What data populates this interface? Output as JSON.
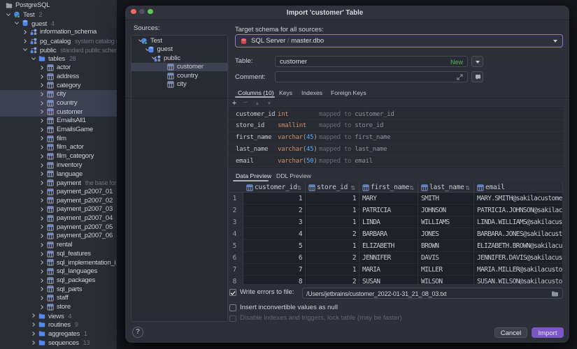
{
  "window": {
    "title": "Import 'customer' Table"
  },
  "sidebar": {
    "items": [
      {
        "label": "PostgreSQL",
        "level": 0,
        "icon": "folder-gray",
        "chevron": "none"
      },
      {
        "label": "Test",
        "level": 1,
        "icon": "postgresql",
        "chevron": "down",
        "badge": "2"
      },
      {
        "label": "guest",
        "level": 2,
        "icon": "database",
        "chevron": "down",
        "badge": "4"
      },
      {
        "label": "information_schema",
        "level": 3,
        "icon": "schema",
        "chevron": "right"
      },
      {
        "label": "pg_catalog",
        "level": 3,
        "icon": "schema",
        "chevron": "right",
        "note": "system catalog s"
      },
      {
        "label": "public",
        "level": 3,
        "icon": "schema",
        "chevron": "down",
        "note": "standard public schema"
      },
      {
        "label": "tables",
        "level": 4,
        "icon": "folder-blue",
        "chevron": "down",
        "badge": "28"
      },
      {
        "label": "actor",
        "level": 5,
        "icon": "table",
        "chevron": "right"
      },
      {
        "label": "address",
        "level": 5,
        "icon": "table",
        "chevron": "right"
      },
      {
        "label": "category",
        "level": 5,
        "icon": "table",
        "chevron": "right"
      },
      {
        "label": "city",
        "level": 5,
        "icon": "table",
        "chevron": "right",
        "selected": true
      },
      {
        "label": "country",
        "level": 5,
        "icon": "table",
        "chevron": "right",
        "selected": true
      },
      {
        "label": "customer",
        "level": 5,
        "icon": "table",
        "chevron": "right",
        "selected": true
      },
      {
        "label": "EmailsAll1",
        "level": 5,
        "icon": "table",
        "chevron": "right"
      },
      {
        "label": "EmailsGame",
        "level": 5,
        "icon": "table",
        "chevron": "right"
      },
      {
        "label": "film",
        "level": 5,
        "icon": "table",
        "chevron": "right"
      },
      {
        "label": "film_actor",
        "level": 5,
        "icon": "table",
        "chevron": "right"
      },
      {
        "label": "film_category",
        "level": 5,
        "icon": "table",
        "chevron": "right"
      },
      {
        "label": "inventory",
        "level": 5,
        "icon": "table",
        "chevron": "right"
      },
      {
        "label": "language",
        "level": 5,
        "icon": "table",
        "chevron": "right"
      },
      {
        "label": "payment",
        "level": 5,
        "icon": "table",
        "chevron": "right",
        "note": "the base for (p"
      },
      {
        "label": "payment_p2007_01",
        "level": 5,
        "icon": "table",
        "chevron": "right"
      },
      {
        "label": "payment_p2007_02",
        "level": 5,
        "icon": "table",
        "chevron": "right"
      },
      {
        "label": "payment_p2007_03",
        "level": 5,
        "icon": "table",
        "chevron": "right"
      },
      {
        "label": "payment_p2007_04",
        "level": 5,
        "icon": "table",
        "chevron": "right"
      },
      {
        "label": "payment_p2007_05",
        "level": 5,
        "icon": "table",
        "chevron": "right"
      },
      {
        "label": "payment_p2007_06",
        "level": 5,
        "icon": "table",
        "chevron": "right"
      },
      {
        "label": "rental",
        "level": 5,
        "icon": "table",
        "chevron": "right"
      },
      {
        "label": "sql_features",
        "level": 5,
        "icon": "table",
        "chevron": "right"
      },
      {
        "label": "sql_implementation_i",
        "level": 5,
        "icon": "table",
        "chevron": "right"
      },
      {
        "label": "sql_languages",
        "level": 5,
        "icon": "table",
        "chevron": "right"
      },
      {
        "label": "sql_packages",
        "level": 5,
        "icon": "table",
        "chevron": "right"
      },
      {
        "label": "sql_parts",
        "level": 5,
        "icon": "table",
        "chevron": "right"
      },
      {
        "label": "staff",
        "level": 5,
        "icon": "table",
        "chevron": "right"
      },
      {
        "label": "store",
        "level": 5,
        "icon": "table",
        "chevron": "right"
      },
      {
        "label": "views",
        "level": 4,
        "icon": "folder-blue",
        "chevron": "right",
        "badge": "4"
      },
      {
        "label": "routines",
        "level": 4,
        "icon": "folder-blue",
        "chevron": "right",
        "badge": "9"
      },
      {
        "label": "aggregates",
        "level": 4,
        "icon": "folder-blue",
        "chevron": "right",
        "badge": "1"
      },
      {
        "label": "sequences",
        "level": 4,
        "icon": "folder-blue",
        "chevron": "right",
        "badge": "13"
      }
    ]
  },
  "dialog": {
    "traffic_lights": {
      "close": "#ec6a5e",
      "minimize": "#50535c",
      "zoom": "#62c554"
    },
    "sources": {
      "label": "Sources:",
      "tree": [
        {
          "label": "Test",
          "level": 0,
          "icon": "postgresql",
          "chevron": "down"
        },
        {
          "label": "guest",
          "level": 1,
          "icon": "database",
          "chevron": "down"
        },
        {
          "label": "public",
          "level": 2,
          "icon": "schema",
          "chevron": "down"
        },
        {
          "label": "customer",
          "level": 3,
          "icon": "table",
          "chevron": "none",
          "selected": true
        },
        {
          "label": "country",
          "level": 3,
          "icon": "table",
          "chevron": "none"
        },
        {
          "label": "city",
          "level": 3,
          "icon": "table",
          "chevron": "none"
        }
      ]
    },
    "target_schema": {
      "label": "Target schema for all sources:",
      "dbms": "SQL Server",
      "separator": "/",
      "schema": "master.dbo"
    },
    "table_row": {
      "label": "Table:",
      "value": "customer",
      "badge": "New"
    },
    "comment_row": {
      "label": "Comment:",
      "value": ""
    },
    "tabs": [
      {
        "label": "Columns (10)",
        "selected": true
      },
      {
        "label": "Keys",
        "selected": false
      },
      {
        "label": "Indexes",
        "selected": false
      },
      {
        "label": "Foreign Keys",
        "selected": false
      }
    ],
    "toolbar": {
      "add": "+",
      "remove": "−",
      "up": "▲",
      "down": "▼"
    },
    "columns": [
      {
        "name": "customer_id",
        "type": "int",
        "size": "",
        "mapped_prefix": "mapped to",
        "mapped": "customer_id"
      },
      {
        "name": "store_id",
        "type": "smallint",
        "size": "",
        "mapped_prefix": "mapped to",
        "mapped": "store_id"
      },
      {
        "name": "first_name",
        "type": "varchar",
        "size": "45",
        "mapped_prefix": "mapped to",
        "mapped": "first_name"
      },
      {
        "name": "last_name",
        "type": "varchar",
        "size": "45",
        "mapped_prefix": "mapped to",
        "mapped": "last_name"
      },
      {
        "name": "email",
        "type": "varchar",
        "size": "50",
        "mapped_prefix": "mapped to",
        "mapped": "email"
      }
    ],
    "preview_tabs": [
      {
        "label": "Data Preview",
        "selected": true
      },
      {
        "label": "DDL Preview",
        "selected": false
      }
    ],
    "grid": {
      "columns": [
        "customer_id",
        "store_id",
        "first_name",
        "last_name",
        "email"
      ],
      "row_numbers": [
        "1",
        "2",
        "3",
        "4",
        "5",
        "6",
        "7",
        "8"
      ],
      "rows": [
        [
          "1",
          "1",
          "MARY",
          "SMITH",
          "MARY.SMITH@sakilacustomer."
        ],
        [
          "2",
          "1",
          "PATRICIA",
          "JOHNSON",
          "PATRICIA.JOHNSON@sakilacus"
        ],
        [
          "3",
          "1",
          "LINDA",
          "WILLIAMS",
          "LINDA.WILLIAMS@sakilacusto"
        ],
        [
          "4",
          "2",
          "BARBARA",
          "JONES",
          "BARBARA.JONES@sakilacustom"
        ],
        [
          "5",
          "1",
          "ELIZABETH",
          "BROWN",
          "ELIZABETH.BROWN@sakilacust"
        ],
        [
          "6",
          "2",
          "JENNIFER",
          "DAVIS",
          "JENNIFER.DAVIS@sakilacusto"
        ],
        [
          "7",
          "1",
          "MARIA",
          "MILLER",
          "MARIA.MILLER@sakilacustome"
        ],
        [
          "8",
          "2",
          "SUSAN",
          "WILSON",
          "SUSAN.WILSON@sakilacustome"
        ]
      ]
    },
    "options": [
      {
        "checked": true,
        "disabled": false,
        "label": "Write errors to file:",
        "value": "/Users/jetbrains/customer_2022-01-31_21_08_03.txt"
      },
      {
        "checked": false,
        "disabled": false,
        "label": "Insert inconvertible values as null"
      },
      {
        "checked": false,
        "disabled": true,
        "label": "Disable indexes and triggers, lock table (may be faster)"
      }
    ],
    "buttons": {
      "cancel": "Cancel",
      "import": "Import"
    },
    "help": "?"
  },
  "colors": {
    "accent_purple": "#7d57c6",
    "combo_focus_border": "#9a72d8",
    "new_badge_green": "#58b45e",
    "type_orange": "#cf8e6d",
    "number_blue": "#56a8f5",
    "folder_blue": "#548af7",
    "selection_gray": "#3d4152"
  }
}
